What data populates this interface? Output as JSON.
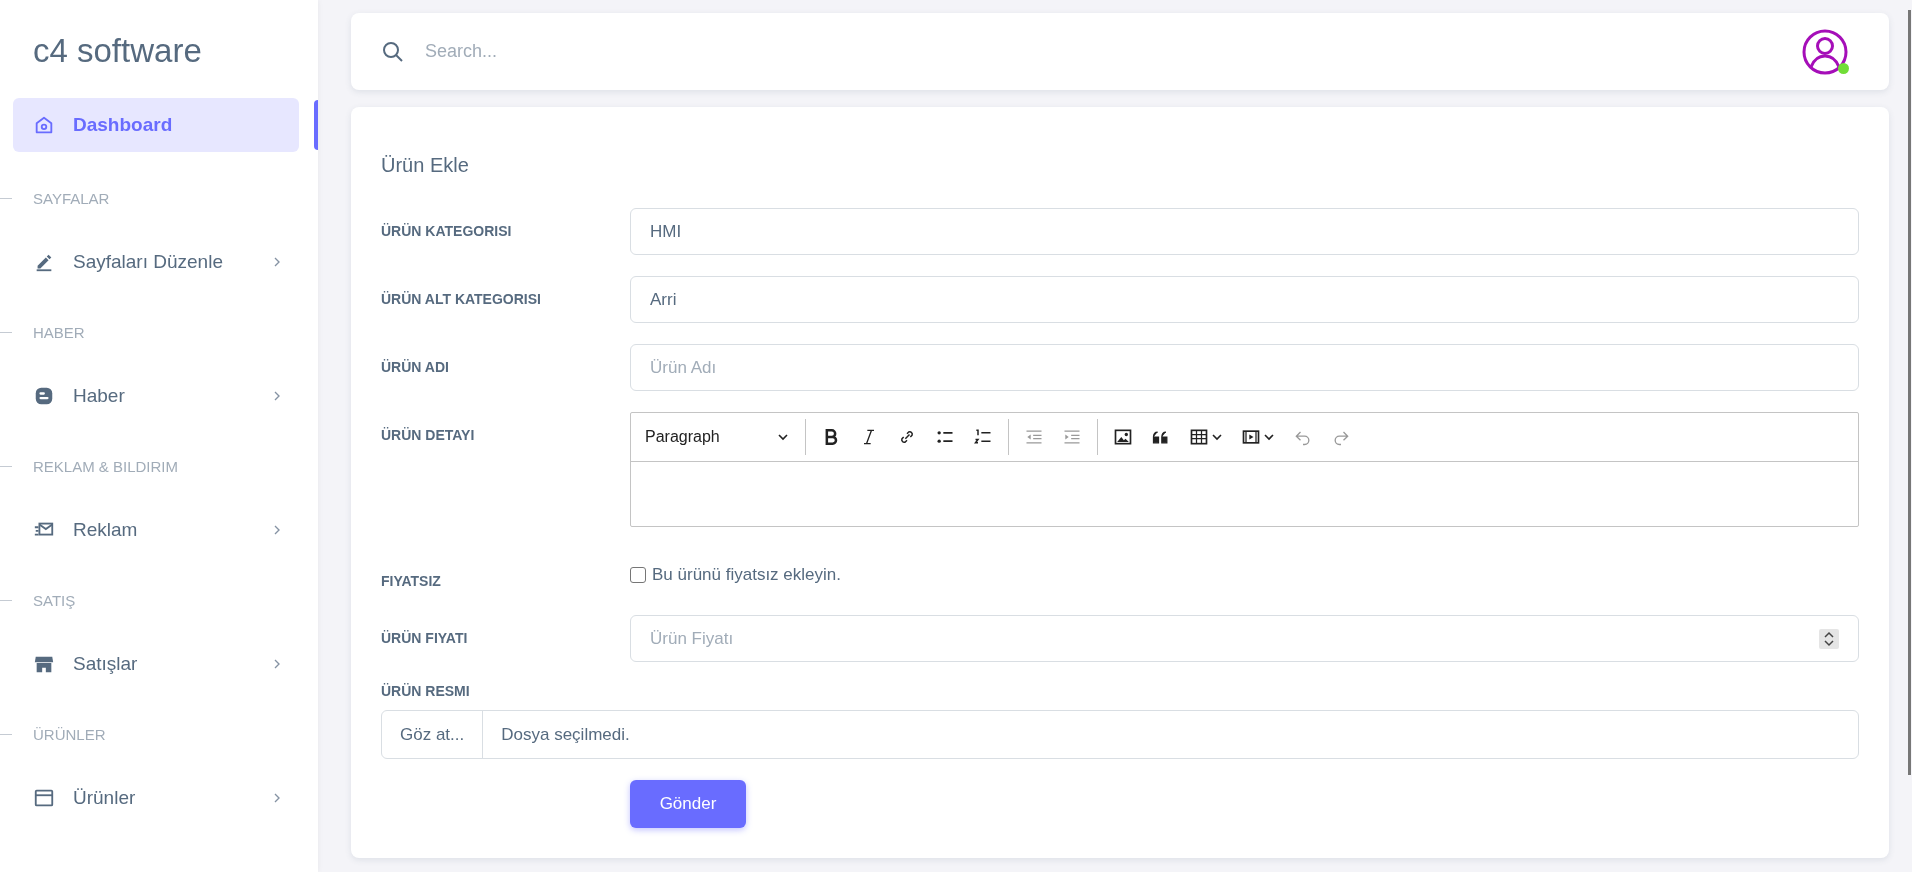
{
  "sidebar": {
    "logo": "c4 software",
    "active_item": {
      "label": "Dashboard",
      "selected": true
    },
    "sections": [
      {
        "heading": "SAYFALAR",
        "items": [
          {
            "label": "Sayfaları Düzenle",
            "expanded": false
          }
        ]
      },
      {
        "heading": "HABER",
        "items": [
          {
            "label": "Haber",
            "expanded": false
          }
        ]
      },
      {
        "heading": "REKLAM & BILDIRIM",
        "items": [
          {
            "label": "Reklam",
            "expanded": false
          }
        ]
      },
      {
        "heading": "SATIŞ",
        "items": [
          {
            "label": "Satışlar",
            "expanded": false
          }
        ]
      },
      {
        "heading": "ÜRÜNLER",
        "items": [
          {
            "label": "Ürünler",
            "expanded": false
          }
        ]
      }
    ]
  },
  "header": {
    "search": {
      "placeholder": "Search..."
    },
    "user": {
      "online": true
    }
  },
  "form": {
    "title": "Ürün Ekle",
    "rows": [
      {
        "kind": "select",
        "label": "ÜRÜN KATEGORISI",
        "value": "HMI"
      },
      {
        "kind": "select",
        "label": "ÜRÜN ALT KATEGORISI",
        "value": "Arri"
      },
      {
        "kind": "text",
        "label": "ÜRÜN ADI",
        "placeholder": "Ürün Adı"
      },
      {
        "kind": "editor",
        "label": "ÜRÜN DETAYI",
        "heading_select": "Paragraph",
        "toolbar_groups": [
          [
            {
              "kind": "bold",
              "disabled": false
            },
            {
              "kind": "italic",
              "disabled": false
            },
            {
              "kind": "link",
              "disabled": false
            },
            {
              "kind": "bullets",
              "disabled": false
            },
            {
              "kind": "numbers",
              "disabled": false
            }
          ],
          [
            {
              "kind": "outdent",
              "disabled": true
            },
            {
              "kind": "indent",
              "disabled": true
            }
          ],
          [
            {
              "kind": "image",
              "disabled": false
            },
            {
              "kind": "quote",
              "disabled": false
            },
            {
              "kind": "table",
              "disabled": false
            },
            {
              "kind": "media",
              "disabled": false
            },
            {
              "kind": "undo",
              "disabled": true
            },
            {
              "kind": "redo",
              "disabled": true
            }
          ]
        ]
      },
      {
        "kind": "checkbox",
        "label": "FIYATSIZ",
        "text": "Bu ürünü fiyatsız ekleyin.",
        "checked": false
      },
      {
        "kind": "number",
        "label": "ÜRÜN FIYATI",
        "placeholder": "Ürün Fiyatı"
      },
      {
        "kind": "file",
        "label": "ÜRÜN RESMI",
        "button": "Göz at...",
        "status": "Dosya seçilmedi."
      }
    ],
    "submit": "Gönder"
  }
}
